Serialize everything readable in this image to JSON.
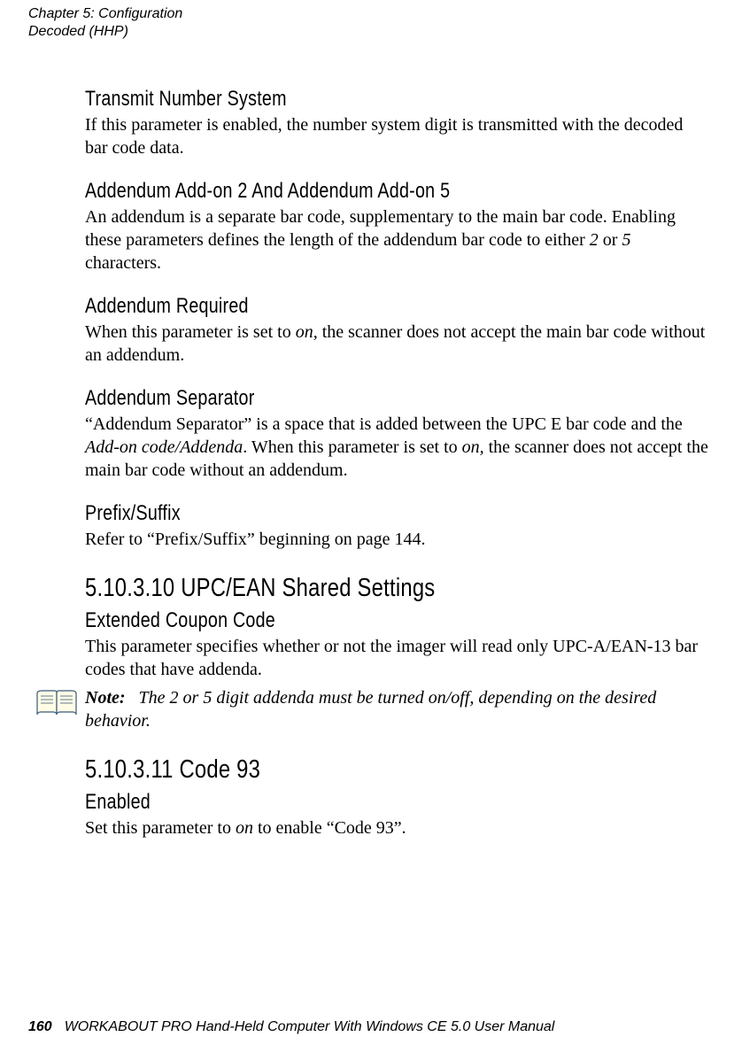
{
  "header": {
    "line1": "Chapter 5: Configuration",
    "line2": "Decoded (HHP)"
  },
  "sections": {
    "transmitNumberSystem": {
      "title": "Transmit Number System",
      "body": "If this parameter is enabled, the number system digit is transmitted with the decoded bar code data."
    },
    "addendum25": {
      "title": "Addendum Add-on 2 And Addendum Add-on 5",
      "body_pre": "An addendum is a separate bar code, supplementary to the main bar code. Enabling these parameters defines the length of the addendum bar code to either ",
      "body_italic1": "2",
      "body_mid": " or ",
      "body_italic2": "5",
      "body_post": " characters."
    },
    "addendumRequired": {
      "title": "Addendum Required",
      "body_pre": "When this parameter is set to ",
      "body_italic": "on,",
      "body_post": " the scanner does not accept the main bar code without an addendum."
    },
    "addendumSeparator": {
      "title": "Addendum Separator",
      "body_pre": "“Addendum Separator” is a space that is added between the UPC E bar code and the ",
      "body_italic1": "Add-on code/Addenda",
      "body_mid": ". When this parameter is set to ",
      "body_italic2": "on,",
      "body_post": " the scanner does not accept the main bar code without an addendum."
    },
    "prefixSuffix": {
      "title": "Prefix/Suffix",
      "body": "Refer to “Prefix/Suffix” beginning on page 144."
    },
    "upcEanShared": {
      "number_title": "5.10.3.10  UPC/EAN Shared Settings"
    },
    "extendedCouponCode": {
      "title": "Extended Coupon Code",
      "body": "This parameter specifies whether or not the imager will read only UPC-A/EAN-13 bar codes that have addenda."
    },
    "note": {
      "label": "Note:",
      "body": "The 2 or 5 digit addenda must be turned on/off, depending on the desired behavior."
    },
    "code93": {
      "number_title": "5.10.3.11  Code 93"
    },
    "enabled": {
      "title": "Enabled",
      "body_pre": "Set this parameter to ",
      "body_italic": "on",
      "body_post": " to enable “Code 93”."
    }
  },
  "footer": {
    "page": "160",
    "text": "WORKABOUT PRO Hand-Held Computer With Windows CE 5.0 User Manual"
  }
}
